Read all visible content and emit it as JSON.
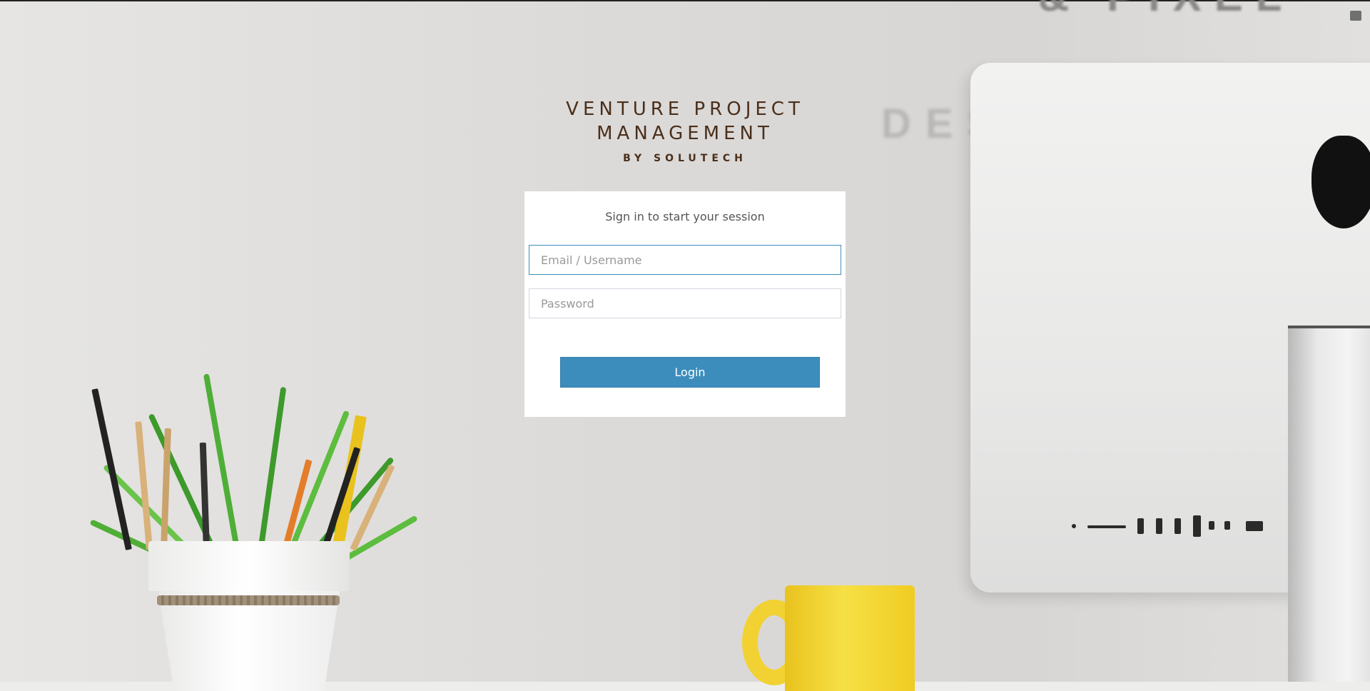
{
  "brand": {
    "title_line1": "VENTURE PROJECT",
    "title_line2": "MANAGEMENT",
    "subtitle": "BY SOLUTECH"
  },
  "login": {
    "message": "Sign in to start your session",
    "email_placeholder": "Email / Username",
    "password_placeholder": "Password",
    "submit_label": "Login"
  },
  "colors": {
    "brand_text": "#4a2f1c",
    "accent": "#3c8dbc",
    "box_bg": "#ffffff"
  },
  "background": {
    "wall_text_top": "& PIXEL",
    "wall_text": "DES"
  },
  "icons": {
    "corner": "briefcase-icon"
  }
}
